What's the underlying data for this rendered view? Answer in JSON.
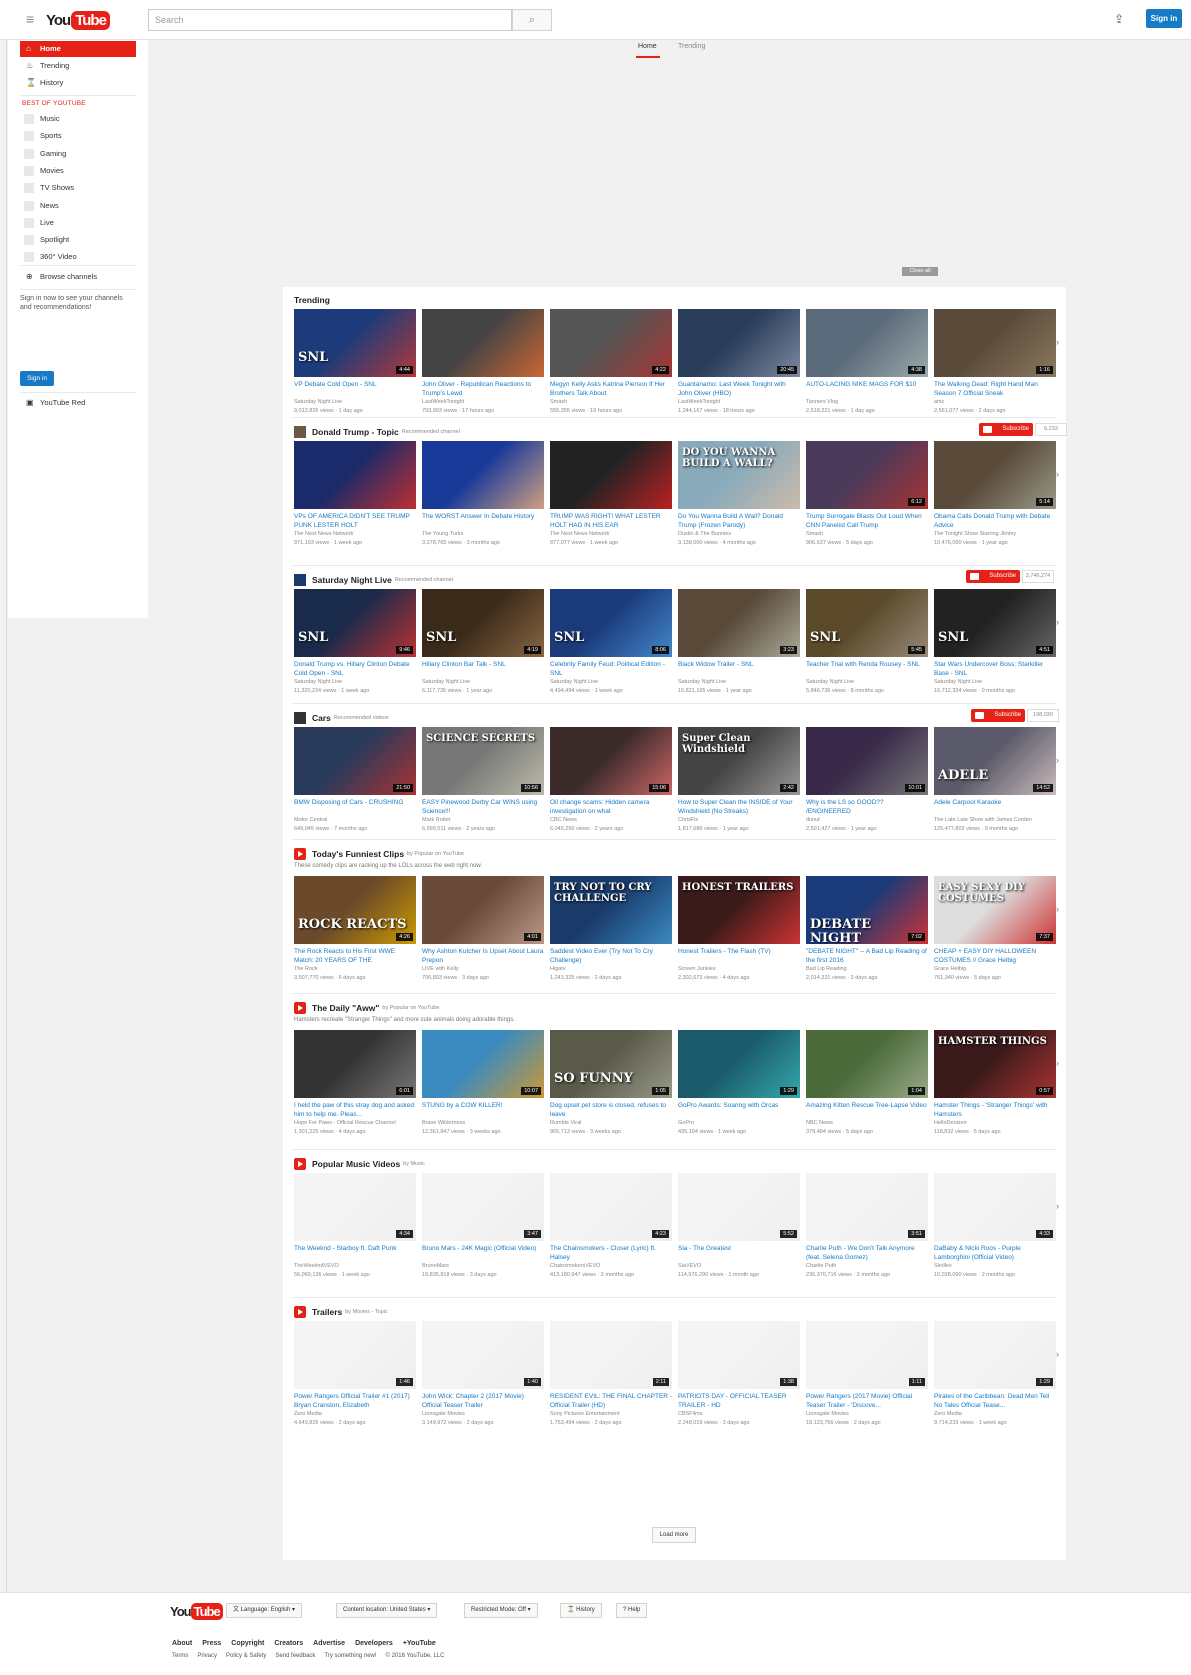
{
  "header": {
    "search_placeholder": "Search",
    "signin": "Sign in"
  },
  "guide": {
    "main": [
      {
        "label": "Home",
        "icon": "home-icon"
      },
      {
        "label": "Trending",
        "icon": "flame-icon"
      },
      {
        "label": "History",
        "icon": "hourglass-icon"
      }
    ],
    "best_heading": "BEST OF YOUTUBE",
    "best": [
      "Music",
      "Sports",
      "Gaming",
      "Movies",
      "TV Shows",
      "News",
      "Live",
      "Spotlight",
      "360° Video"
    ],
    "browse": "Browse channels",
    "signin_text": "Sign in now to see your channels and recommendations!",
    "signin_button": "Sign in",
    "feed": "YouTube Red"
  },
  "tabs": [
    "Home",
    "Trending"
  ],
  "close_all": "Close all",
  "shelves": [
    {
      "title": "Trending",
      "sub": "",
      "desc": "",
      "subscribe": "",
      "count": "",
      "videos": [
        {
          "title": "VP Debate Cold Open - SNL",
          "channel": "Saturday Night Live",
          "meta": "9,012,826 views · 1 day ago",
          "dur": "4:44",
          "c1": "#1d3b7a",
          "c2": "#b23a3a",
          "label": "SNL"
        },
        {
          "title": "John Oliver - Republican Reactions to Trump's Lewd",
          "channel": "LastWeekTonight",
          "meta": "793,993 views · 17 hours ago",
          "dur": "",
          "c1": "#444",
          "c2": "#c63",
          "label": ""
        },
        {
          "title": "Megyn Kelly Asks Katrina Pierson If Her Brothers Talk About",
          "channel": "Smash",
          "meta": "555,355 views · 19 hours ago",
          "dur": "4:22",
          "c1": "#555",
          "c2": "#a33",
          "label": ""
        },
        {
          "title": "Guantánamo: Last Week Tonight with John Oliver (HBO)",
          "channel": "LastWeekTonight",
          "meta": "1,244,167 views · 18 hours ago",
          "dur": "20:45",
          "c1": "#2a3d5a",
          "c2": "#7d8aa0",
          "label": ""
        },
        {
          "title": "AUTO-LACING NIKE MAGS FOR $10",
          "channel": "Tanners Vlog",
          "meta": "2,618,221 views · 1 day ago",
          "dur": "4:38",
          "c1": "#5b6a7a",
          "c2": "#9aa",
          "label": ""
        },
        {
          "title": "The Walking Dead: Right Hand Man Season 7 Official Sneak",
          "channel": "amc",
          "meta": "2,561,077 views · 2 days ago",
          "dur": "1:16",
          "c1": "#5a4a3a",
          "c2": "#8a7a60",
          "label": ""
        }
      ]
    },
    {
      "title": "Donald Trump - Topic",
      "sub": "Recommended channel",
      "desc": "",
      "subscribe": "Subscribe",
      "count": "6,233",
      "videos": [
        {
          "title": "VPs OF AMERICA DIDN'T SEE TRUMP PUNK LESTER HOLT",
          "channel": "The Next News Network",
          "meta": "971,193 views · 1 week ago",
          "dur": "",
          "c1": "#1a2a6a",
          "c2": "#c03030",
          "label": ""
        },
        {
          "title": "The WORST Answer In Debate History",
          "channel": "The Young Turks",
          "meta": "3,278,765 views · 3 months ago",
          "dur": "",
          "c1": "#1a3a9a",
          "c2": "#d0a080",
          "label": ""
        },
        {
          "title": "TRUMP WAS RIGHT! WHAT LESTER HOLT HAD IN HIS EAR",
          "channel": "The Next News Network",
          "meta": "877,077 views · 1 week ago",
          "dur": "",
          "c1": "#222",
          "c2": "#b22",
          "label": ""
        },
        {
          "title": "Do You Wanna Build A Wall? Donald Trump (Frozen Parody)",
          "channel": "Dustin & The Bunnies",
          "meta": "3,138,000 views · 4 months ago",
          "dur": "",
          "c1": "#8ab",
          "c2": "#cba",
          "label": "DO YOU WANNA BUILD A WALL?"
        },
        {
          "title": "Trump Surrogate Blasts Out Loud When CNN Panelist Call Trump",
          "channel": "Smash",
          "meta": "906,637 views · 5 days ago",
          "dur": "6:12",
          "c1": "#4a3a5a",
          "c2": "#a33",
          "label": ""
        },
        {
          "title": "Obama Calls Donald Trump with Debate Advice",
          "channel": "The Tonight Show Starring Jimmy",
          "meta": "10,476,090 views · 1 year ago",
          "dur": "5:14",
          "c1": "#5a4a3a",
          "c2": "#998",
          "label": ""
        }
      ]
    },
    {
      "title": "Saturday Night Live",
      "sub": "Recommended channel",
      "desc": "",
      "subscribe": "Subscribe",
      "count": "3,746,274",
      "videos": [
        {
          "title": "Donald Trump vs. Hillary Clinton Debate Cold Open - SNL",
          "channel": "Saturday Night Live",
          "meta": "11,320,234 views · 1 week ago",
          "dur": "9:46",
          "c1": "#1a2a4a",
          "c2": "#b33",
          "label": "SNL"
        },
        {
          "title": "Hillary Clinton Bar Talk - SNL",
          "channel": "Saturday Night Live",
          "meta": "6,117,735 views · 1 year ago",
          "dur": "4:19",
          "c1": "#3a2a1a",
          "c2": "#864",
          "label": "SNL"
        },
        {
          "title": "Celebrity Family Feud: Political Edition - SNL",
          "channel": "Saturday Night Live",
          "meta": "4,494,494 views · 1 week ago",
          "dur": "8:06",
          "c1": "#1a3a7a",
          "c2": "#48c",
          "label": "SNL"
        },
        {
          "title": "Black Widow Trailer - SNL",
          "channel": "Saturday Night Live",
          "meta": "16,821,195 views · 1 year ago",
          "dur": "3:23",
          "c1": "#5a4a3a",
          "c2": "#aa9",
          "label": ""
        },
        {
          "title": "Teacher Trial with Renda Rousey - SNL",
          "channel": "Saturday Night Live",
          "meta": "5,846,736 views · 8 months ago",
          "dur": "5:45",
          "c1": "#5a4a2a",
          "c2": "#987",
          "label": "SNL"
        },
        {
          "title": "Star Wars Undercover Boss: Starkiller Base - SNL",
          "channel": "Saturday Night Live",
          "meta": "16,712,334 views · 9 months ago",
          "dur": "4:51",
          "c1": "#222",
          "c2": "#666",
          "label": "SNL"
        }
      ]
    },
    {
      "title": "Cars",
      "sub": "Recommended videos",
      "desc": "",
      "subscribe": "Subscribe",
      "count": "198,030",
      "videos": [
        {
          "title": "BMW Disposing of Cars - CRUSHING",
          "channel": "Motor Central",
          "meta": "649,945 views · 7 months ago",
          "dur": "21:50",
          "c1": "#2a3a5a",
          "c2": "#a33",
          "label": ""
        },
        {
          "title": "EASY Pinewood Derby Car WINS using Science!!!",
          "channel": "Mark Rober",
          "meta": "6,999,511 views · 2 years ago",
          "dur": "10:56",
          "c1": "#777",
          "c2": "#bba",
          "label": "SCIENCE SECRETS"
        },
        {
          "title": "Oil change scams: Hidden camera investigation on what",
          "channel": "CBC News",
          "meta": "6,045,250 views · 2 years ago",
          "dur": "15:06",
          "c1": "#3a2a2a",
          "c2": "#c66",
          "label": ""
        },
        {
          "title": "How to Super Clean the INSIDE of Your Windshield (No Streaks)",
          "channel": "ChrisFix",
          "meta": "1,817,686 views · 1 year ago",
          "dur": "2:42",
          "c1": "#444",
          "c2": "#999",
          "label": "Super Clean Windshield"
        },
        {
          "title": "Why is the LS so GOOD?? /ENGINEERED",
          "channel": "donut",
          "meta": "2,501,427 views · 1 year ago",
          "dur": "10:01",
          "c1": "#3a2a4a",
          "c2": "#777",
          "label": ""
        },
        {
          "title": "Adele Carpool Karaoke",
          "channel": "The Late Late Show with James Corden",
          "meta": "125,477,803 views · 9 months ago",
          "dur": "14:52",
          "c1": "#5a5a6a",
          "c2": "#cbb",
          "label": "ADELE"
        }
      ]
    },
    {
      "title": "Today's Funniest Clips",
      "sub": "by Popular on YouTube",
      "desc": "These comedy clips are racking up the LOLs across the web right now.",
      "subscribe": "",
      "count": "",
      "videos": [
        {
          "title": "The Rock Reacts to His First WWE Match: 20 YEARS OF THE",
          "channel": "The Rock",
          "meta": "3,507,770 views · 6 days ago",
          "dur": "4:26",
          "c1": "#6a4a2a",
          "c2": "#c90",
          "label": "ROCK REACTS"
        },
        {
          "title": "Why Ashton Kutcher Is Upset About Laura Prepon",
          "channel": "LIVE with Kelly",
          "meta": "706,893 views · 3 days ago",
          "dur": "4:01",
          "c1": "#6a4a3a",
          "c2": "#b98",
          "label": ""
        },
        {
          "title": "Saddest Video Ever (Try Not To Cry Challenge)",
          "channel": "Higatv",
          "meta": "1,243,325 views · 2 days ago",
          "dur": "",
          "c1": "#1a3a6a",
          "c2": "#3a8ac0",
          "label": "TRY NOT TO CRY CHALLENGE"
        },
        {
          "title": "Honest Trailers - The Flash (TV)",
          "channel": "Screen Junkies",
          "meta": "2,302,673 views · 4 days ago",
          "dur": "",
          "c1": "#3a1a1a",
          "c2": "#c33",
          "label": "HONEST TRAILERS"
        },
        {
          "title": "\"DEBATE NIGHT\" -- A Bad Lip Reading of the first 2016",
          "channel": "Bad Lip Reading",
          "meta": "2,014,331 views · 3 days ago",
          "dur": "7:02",
          "c1": "#1a3a7a",
          "c2": "#c33",
          "label": "DEBATE NIGHT"
        },
        {
          "title": "CHEAP + EASY DIY HALLOWEEN COSTUMES // Grace Helbig",
          "channel": "Grace Helbig",
          "meta": "761,340 views · 5 days ago",
          "dur": "7:37",
          "c1": "#ddd",
          "c2": "#c33",
          "label": "EASY SEXY DIY COSTUMES"
        }
      ]
    },
    {
      "title": "The Daily \"Aww\"",
      "sub": "by Popular on YouTube",
      "desc": "Hamsters recreate \"Stranger Things\" and more cute animals doing adorable things.",
      "subscribe": "",
      "count": "",
      "videos": [
        {
          "title": "I held the paw of this stray dog and asked him to help me. Pleas...",
          "channel": "Hope For Paws - Official Rescue Channel",
          "meta": "1,301,225 views · 4 days ago",
          "dur": "6:01",
          "c1": "#333",
          "c2": "#777",
          "label": ""
        },
        {
          "title": "STUNG by a COW KILLER!",
          "channel": "Brave Wilderness",
          "meta": "12,361,847 views · 3 weeks ago",
          "dur": "10:07",
          "c1": "#3a8ac0",
          "c2": "#c93",
          "label": ""
        },
        {
          "title": "Dog upset pet store is closed, refuses to leave",
          "channel": "Rumble Viral",
          "meta": "965,713 views · 3 weeks ago",
          "dur": "1:05",
          "c1": "#5a5a4a",
          "c2": "#998",
          "label": "SO FUNNY"
        },
        {
          "title": "GoPro Awards: Soaring with Orcas",
          "channel": "GoPro",
          "meta": "435,194 views · 1 week ago",
          "dur": "1:29",
          "c1": "#1a5a6a",
          "c2": "#3aa",
          "label": ""
        },
        {
          "title": "Amazing Kitten Rescue Tree-Lapse Video",
          "channel": "NBC News",
          "meta": "379,484 views · 5 days ago",
          "dur": "1:04",
          "c1": "#4a6a3a",
          "c2": "#9a8",
          "label": ""
        },
        {
          "title": "Hamster Things - 'Stranger Things' with Hamsters",
          "channel": "HelloDenizen",
          "meta": "118,832 views · 5 days ago",
          "dur": "0:57",
          "c1": "#3a1a1a",
          "c2": "#a33",
          "label": "HAMSTER THINGS"
        }
      ]
    },
    {
      "title": "Popular Music Videos",
      "sub": "by Music",
      "desc": "",
      "subscribe": "",
      "count": "",
      "videos": [
        {
          "title": "The Weeknd - Starboy ft. Daft Punk",
          "channel": "TheWeekndVEVO",
          "meta": "56,069,136 views · 1 week ago",
          "dur": "4:34",
          "c1": "#f4f4f4",
          "c2": "#eee",
          "label": ""
        },
        {
          "title": "Bruno Mars - 24K Magic (Official Video)",
          "channel": "BrunoMars",
          "meta": "19,835,818 views · 3 days ago",
          "dur": "3:47",
          "c1": "#f4f4f4",
          "c2": "#eee",
          "label": ""
        },
        {
          "title": "The Chainsmokers - Closer (Lyric) ft. Halsey",
          "channel": "ChainsmokersVEVO",
          "meta": "413,180,947 views · 2 months ago",
          "dur": "4:23",
          "c1": "#f4f4f4",
          "c2": "#eee",
          "label": ""
        },
        {
          "title": "Sia - The Greatest",
          "channel": "SiaVEVO",
          "meta": "114,976,290 views · 1 month ago",
          "dur": "5:52",
          "c1": "#f4f4f4",
          "c2": "#eee",
          "label": ""
        },
        {
          "title": "Charlie Puth - We Don't Talk Anymore (feat. Selena Gomez)",
          "channel": "Charlie Puth",
          "meta": "236,376,716 views · 2 months ago",
          "dur": "3:51",
          "c1": "#f4f4f4",
          "c2": "#eee",
          "label": ""
        },
        {
          "title": "DaBaby & Nicki Roos - Purple Lamborghini (Official Video)",
          "channel": "Skrillex",
          "meta": "10,028,090 views · 2 months ago",
          "dur": "4:33",
          "c1": "#f4f4f4",
          "c2": "#eee",
          "label": ""
        }
      ]
    },
    {
      "title": "Trailers",
      "sub": "by Movies - Topic",
      "desc": "",
      "subscribe": "",
      "count": "",
      "videos": [
        {
          "title": "Power Rangers Official Trailer #1 (2017) Bryan Cranston, Elizabeth",
          "channel": "Zero Media",
          "meta": "4,649,826 views · 2 days ago",
          "dur": "1:46",
          "c1": "#f4f4f4",
          "c2": "#eee",
          "label": ""
        },
        {
          "title": "John Wick: Chapter 2 (2017 Movie) Official Teaser Trailer",
          "channel": "Lionsgate Movies",
          "meta": "3,149,972 views · 2 days ago",
          "dur": "1:40",
          "c1": "#f4f4f4",
          "c2": "#eee",
          "label": ""
        },
        {
          "title": "RESIDENT EVIL: THE FINAL CHAPTER - Official Trailer (HD)",
          "channel": "Sony Pictures Entertainment",
          "meta": "1,753,494 views · 2 days ago",
          "dur": "2:11",
          "c1": "#f4f4f4",
          "c2": "#eee",
          "label": ""
        },
        {
          "title": "PATRIOTS DAY - OFFICIAL TEASER TRAILER - HD",
          "channel": "CBSFilms",
          "meta": "2,248,019 views · 3 days ago",
          "dur": "1:38",
          "c1": "#f4f4f4",
          "c2": "#eee",
          "label": ""
        },
        {
          "title": "Power Rangers (2017 Movie) Official Teaser Trailer - 'Discove...",
          "channel": "Lionsgate Movies",
          "meta": "18,123,756 views · 2 days ago",
          "dur": "1:11",
          "c1": "#f4f4f4",
          "c2": "#eee",
          "label": ""
        },
        {
          "title": "Pirates of the Caribbean: Dead Men Tell No Tales Official Tease...",
          "channel": "Zero Media",
          "meta": "9,714,233 views · 1 week ago",
          "dur": "1:29",
          "c1": "#f4f4f4",
          "c2": "#eee",
          "label": ""
        }
      ]
    }
  ],
  "load_more": "Load more",
  "footer": {
    "language": "Language: English",
    "location": "Content location: United States",
    "restricted": "Restricted Mode: Off",
    "history": "History",
    "help": "Help",
    "links1": [
      "About",
      "Press",
      "Copyright",
      "Creators",
      "Advertise",
      "Developers",
      "+YouTube"
    ],
    "links2": [
      "Terms",
      "Privacy",
      "Policy & Safety",
      "Send feedback",
      "Try something new!",
      "© 2016 YouTube, LLC"
    ]
  }
}
